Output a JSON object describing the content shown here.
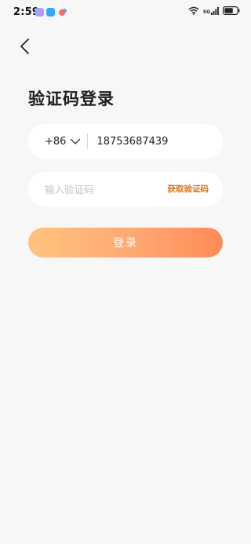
{
  "status_bar": {
    "time": "2:59",
    "network_label": "5G",
    "app_icons": [
      "photo-app-icon",
      "cloud-app-icon",
      "notification-dot-icon"
    ],
    "right_icons": [
      "wifi-icon",
      "signal-icon",
      "battery-icon"
    ]
  },
  "header": {
    "back_icon": "chevron-left-icon"
  },
  "page": {
    "title": "验证码登录"
  },
  "phone_field": {
    "country_code": "+86",
    "value": "18753687439"
  },
  "code_field": {
    "placeholder": "输入验证码",
    "value": "",
    "get_code_label": "获取验证码"
  },
  "login_button": {
    "label": "登录"
  },
  "colors": {
    "background": "#f7f7f7",
    "field_background": "#ffffff",
    "accent_text": "#d4741c",
    "button_gradient_start": "#ffc37e",
    "button_gradient_end": "#ff8a57"
  }
}
